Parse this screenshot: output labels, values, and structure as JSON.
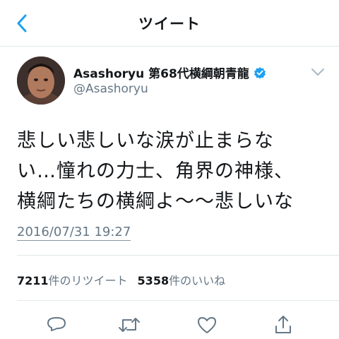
{
  "header": {
    "title": "ツイート"
  },
  "tweet": {
    "display_name": "Asashoryu 第68代横綱朝青龍",
    "handle": "@Asashoryu",
    "text_lines": [
      "悲しい悲しいな涙が止まらな",
      "い…憧れの力士、角界の神様、",
      "横綱たちの横綱よ〜〜悲しいな"
    ],
    "timestamp": "2016/07/31 19:27"
  },
  "stats": {
    "retweets": {
      "count": "7211",
      "label": "件のリツイート"
    },
    "likes": {
      "count": "5358",
      "label": "件のいいね"
    }
  },
  "icons": [
    "back-chevron",
    "verified-badge",
    "chevron-down",
    "reply",
    "retweet",
    "like",
    "share"
  ],
  "colors": {
    "accent": "#1da1f2",
    "secondary_text": "#657786",
    "divider": "#e1e8ed"
  }
}
